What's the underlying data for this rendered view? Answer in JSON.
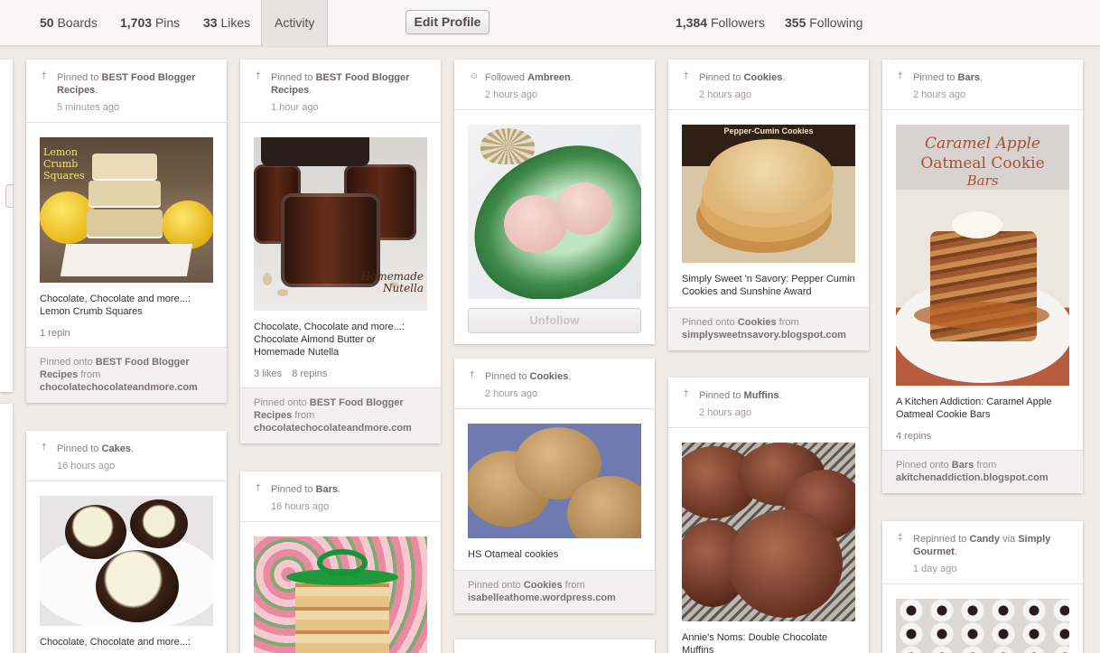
{
  "stats": {
    "boards_count": "50",
    "boards_label": "Boards",
    "pins_count": "1,703",
    "pins_label": "Pins",
    "likes_count": "33",
    "likes_label": "Likes",
    "activity_label": "Activity",
    "edit_profile": "Edit Profile",
    "followers_count": "1,384",
    "followers_label": "Followers",
    "following_count": "355",
    "following_label": "Following"
  },
  "colors": {
    "accent_text": "#524d4d",
    "card_footer_bg": "#f2f0f0",
    "page_bg": "#eeebe9"
  },
  "cards": [
    {
      "icon": "pin-icon",
      "action": "Pinned to",
      "board": "BEST Food Blogger Recipes",
      "time": "5 minutes ago",
      "image_text": "Lemon Crumb Squares",
      "desc": "Chocolate, Chocolate and more...: Lemon Crumb Squares",
      "repins": "1 repin",
      "foot_prefix": "Pinned onto",
      "foot_board": "BEST Food Blogger Recipes",
      "foot_from": "from",
      "source": "chocolatechocolateandmore.com"
    },
    {
      "icon": "pin-icon",
      "action": "Pinned to",
      "board": "Cakes",
      "time": "16 hours ago",
      "desc": "Chocolate, Chocolate and more...:"
    },
    {
      "icon": "pin-icon",
      "action": "Pinned to",
      "board": "BEST Food Blogger Recipes",
      "time": "1 hour ago",
      "image_text": "Homemade Nutella",
      "desc": "Chocolate, Chocolate and more...: Chocolate Almond Butter or Homemade Nutella",
      "likes": "3 likes",
      "repins": "8 repins",
      "foot_prefix": "Pinned onto",
      "foot_board": "BEST Food Blogger Recipes",
      "foot_from": "from",
      "source": "chocolatechocolateandmore.com"
    },
    {
      "icon": "pin-icon",
      "action": "Pinned to",
      "board": "Bars",
      "time": "16 hours ago"
    },
    {
      "icon": "user-icon",
      "action": "Followed",
      "board": "Ambreen",
      "time": "2 hours ago",
      "button": "Unfollow"
    },
    {
      "icon": "pin-icon",
      "action": "Pinned to",
      "board": "Cookies",
      "time": "2 hours ago",
      "desc": "HS Otameal cookies",
      "foot_prefix": "Pinned onto",
      "foot_board": "Cookies",
      "foot_from": "from",
      "source": "isabelleathome.wordpress.com"
    },
    {
      "icon": "pin-icon",
      "action": "Pinned to",
      "board": "Cookies",
      "time": "2 hours ago",
      "image_text": "Pepper-Cumin Cookies",
      "desc": "Simply Sweet 'n Savory: Pepper Cumin Cookies and Sunshine Award",
      "foot_prefix": "Pinned onto",
      "foot_board": "Cookies",
      "foot_from": "from",
      "source": "simplysweetnsavory.blogspot.com"
    },
    {
      "icon": "pin-icon",
      "action": "Pinned to",
      "board": "Muffins",
      "time": "2 hours ago",
      "desc": "Annie's Noms: Double Chocolate Muffins"
    },
    {
      "icon": "pin-icon",
      "action": "Pinned to",
      "board": "Bars",
      "time": "2 hours ago",
      "image_text_1": "Caramel Apple",
      "image_text_2": "Oatmeal Cookie",
      "image_text_3": "Bars",
      "desc": "A Kitchen Addiction: Caramel Apple Oatmeal Cookie Bars",
      "repins": "4 repins",
      "foot_prefix": "Pinned onto",
      "foot_board": "Bars",
      "foot_from": "from",
      "source": "akitchenaddiction.blogspot.com"
    },
    {
      "icon": "repin-icon",
      "action": "Repinned to",
      "board": "Candy",
      "via": "via",
      "via_user": "Simply Gourmet",
      "time": "1 day ago"
    }
  ]
}
